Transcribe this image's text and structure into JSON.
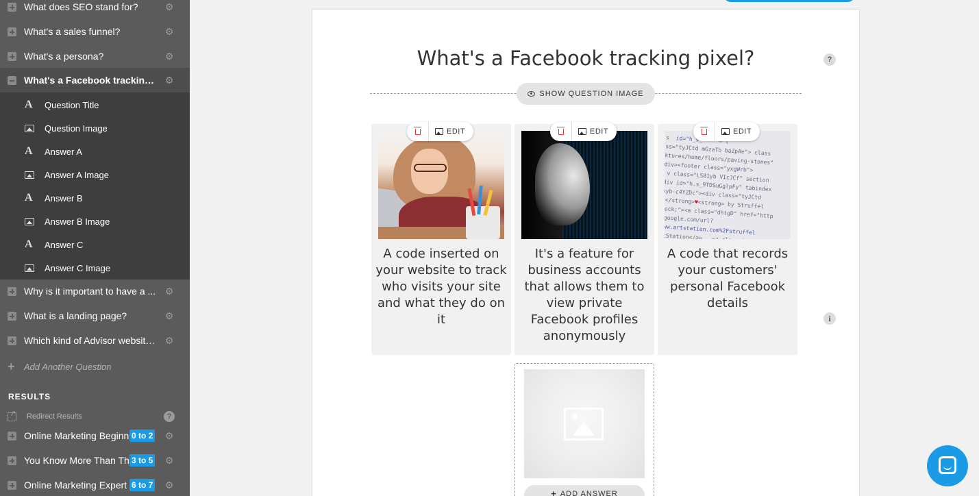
{
  "sidebar": {
    "questions_top": [
      {
        "label": "What does SEO stand for?",
        "expanded": false
      },
      {
        "label": "What's a sales funnel?",
        "expanded": false
      },
      {
        "label": "What's a persona?",
        "expanded": false
      },
      {
        "label": "What's a Facebook tracking pi...",
        "expanded": true
      }
    ],
    "sub_items": [
      {
        "label": "Question Title",
        "icon": "text-icon"
      },
      {
        "label": "Question Image",
        "icon": "image-icon"
      },
      {
        "label": "Answer A",
        "icon": "text-icon"
      },
      {
        "label": "Answer A Image",
        "icon": "image-icon"
      },
      {
        "label": "Answer B",
        "icon": "text-icon"
      },
      {
        "label": "Answer B Image",
        "icon": "image-icon"
      },
      {
        "label": "Answer C",
        "icon": "text-icon"
      },
      {
        "label": "Answer C Image",
        "icon": "image-icon"
      }
    ],
    "questions_bottom": [
      {
        "label": "Why is it important to have a ..."
      },
      {
        "label": "What is a landing page?"
      },
      {
        "label": "Which kind of Advisor website..."
      }
    ],
    "add_question_label": "Add Another Question",
    "results_heading": "RESULTS",
    "redirect_label": "Redirect Results",
    "results": [
      {
        "label": "Online Marketing Beginn",
        "range": "0 to 2"
      },
      {
        "label": "You Know More Than The",
        "range": "3 to 5"
      },
      {
        "label": "Online Marketing Expert",
        "range": "6 to 7"
      }
    ]
  },
  "question": {
    "title": "What's a Facebook tracking pixel?",
    "help_glyph": "?",
    "show_image_label": "SHOW QUESTION IMAGE"
  },
  "answers": [
    {
      "edit_label": "EDIT",
      "text": "A code inserted on your website to track who visits your site and what they do on it"
    },
    {
      "edit_label": "EDIT",
      "text": "It's a feature for business accounts that allows them to view private Facebook profiles anonymously"
    },
    {
      "edit_label": "EDIT",
      "text": "A code that records your customers' personal Facebook details"
    }
  ],
  "info_glyph": "i",
  "add_answer_label": "ADD ANSWER",
  "colors": {
    "accent": "#1b9be6",
    "sidebar": "#5b5b5b",
    "sidebar_active": "#3e3e3e",
    "delete": "#e03a3a"
  }
}
